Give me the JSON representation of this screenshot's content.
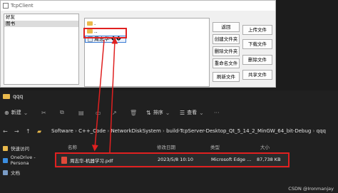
{
  "client": {
    "title": "TcpClient",
    "friends": [
      "好友",
      "图书"
    ],
    "files": [
      {
        "name": "."
      },
      {
        "name": ".."
      },
      {
        "name": "周志华-��"
      }
    ],
    "left_buttons": [
      "返回",
      "创建文件夹",
      "删除文件夹",
      "重命名文件",
      "刷新文件"
    ],
    "right_buttons": [
      "上传文件",
      "下载文件",
      "删除文件",
      "共享文件"
    ]
  },
  "explorer": {
    "tab_title": "qqq",
    "toolbar": {
      "new_label": "新建",
      "sort_label": "排序",
      "view_label": "查看"
    },
    "address": [
      "Software",
      "C++_Code",
      "NetworkDiskSystem",
      "build-TcpServer-Desktop_Qt_5_14_2_MinGW_64_bit-Debug",
      "qqq"
    ],
    "sidebar": [
      {
        "label": "快速访问",
        "color": "#e9b94c"
      },
      {
        "label": "OneDrive - Persona",
        "color": "#3b8ee0"
      },
      {
        "label": "文档",
        "color": "#7a9cc6"
      }
    ],
    "columns": {
      "name": "名称",
      "date": "修改日期",
      "type": "类型",
      "size": "大小"
    },
    "files": [
      {
        "name": "周志华-机器学习.pdf",
        "date": "2023/5/8 10:10",
        "type": "Microsoft Edge ...",
        "size": "87,738 KB"
      }
    ]
  },
  "watermark": "CSDN @Ironmanjay",
  "annotation_color": "#e02020"
}
